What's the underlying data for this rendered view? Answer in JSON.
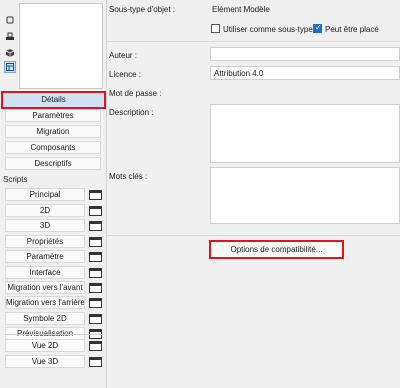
{
  "left_panel": {
    "tools": [
      "square-outline-icon",
      "printer-icon",
      "cube-icon",
      "layout-icon"
    ],
    "tabs": [
      "Détails",
      "Paramètres",
      "Migration",
      "Composants",
      "Descriptifs"
    ],
    "scripts_heading": "Scripts",
    "scripts": [
      "Principal",
      "2D",
      "3D",
      "Propriétés",
      "Paramètre",
      "Interface",
      "Migration vers l'avant",
      "Migration vers l'arrière",
      "Symbole 2D",
      "Prévisualisation"
    ],
    "views": [
      "Vue 2D",
      "Vue 3D"
    ]
  },
  "details": {
    "subtype_label": "Sous-type d'objet :",
    "subtype_value": "Elément Modèle",
    "use_as_subtype_label": "Utiliser comme sous-type",
    "use_as_subtype_checked": false,
    "can_be_placed_label": "Peut être placé",
    "can_be_placed_checked": true,
    "author_label": "Auteur :",
    "author_value": "",
    "license_label": "Licence :",
    "license_value": "Attribution 4.0",
    "password_label": "Mot de passe :",
    "description_label": "Description :",
    "description_value": "",
    "keywords_label": "Mots clés :",
    "keywords_value": "",
    "compat_button": "Options de compatibilité..."
  },
  "colors": {
    "highlight": "#e0141e",
    "selected_bg": "#cfe3f5",
    "checkbox_on": "#1f6fd1"
  }
}
